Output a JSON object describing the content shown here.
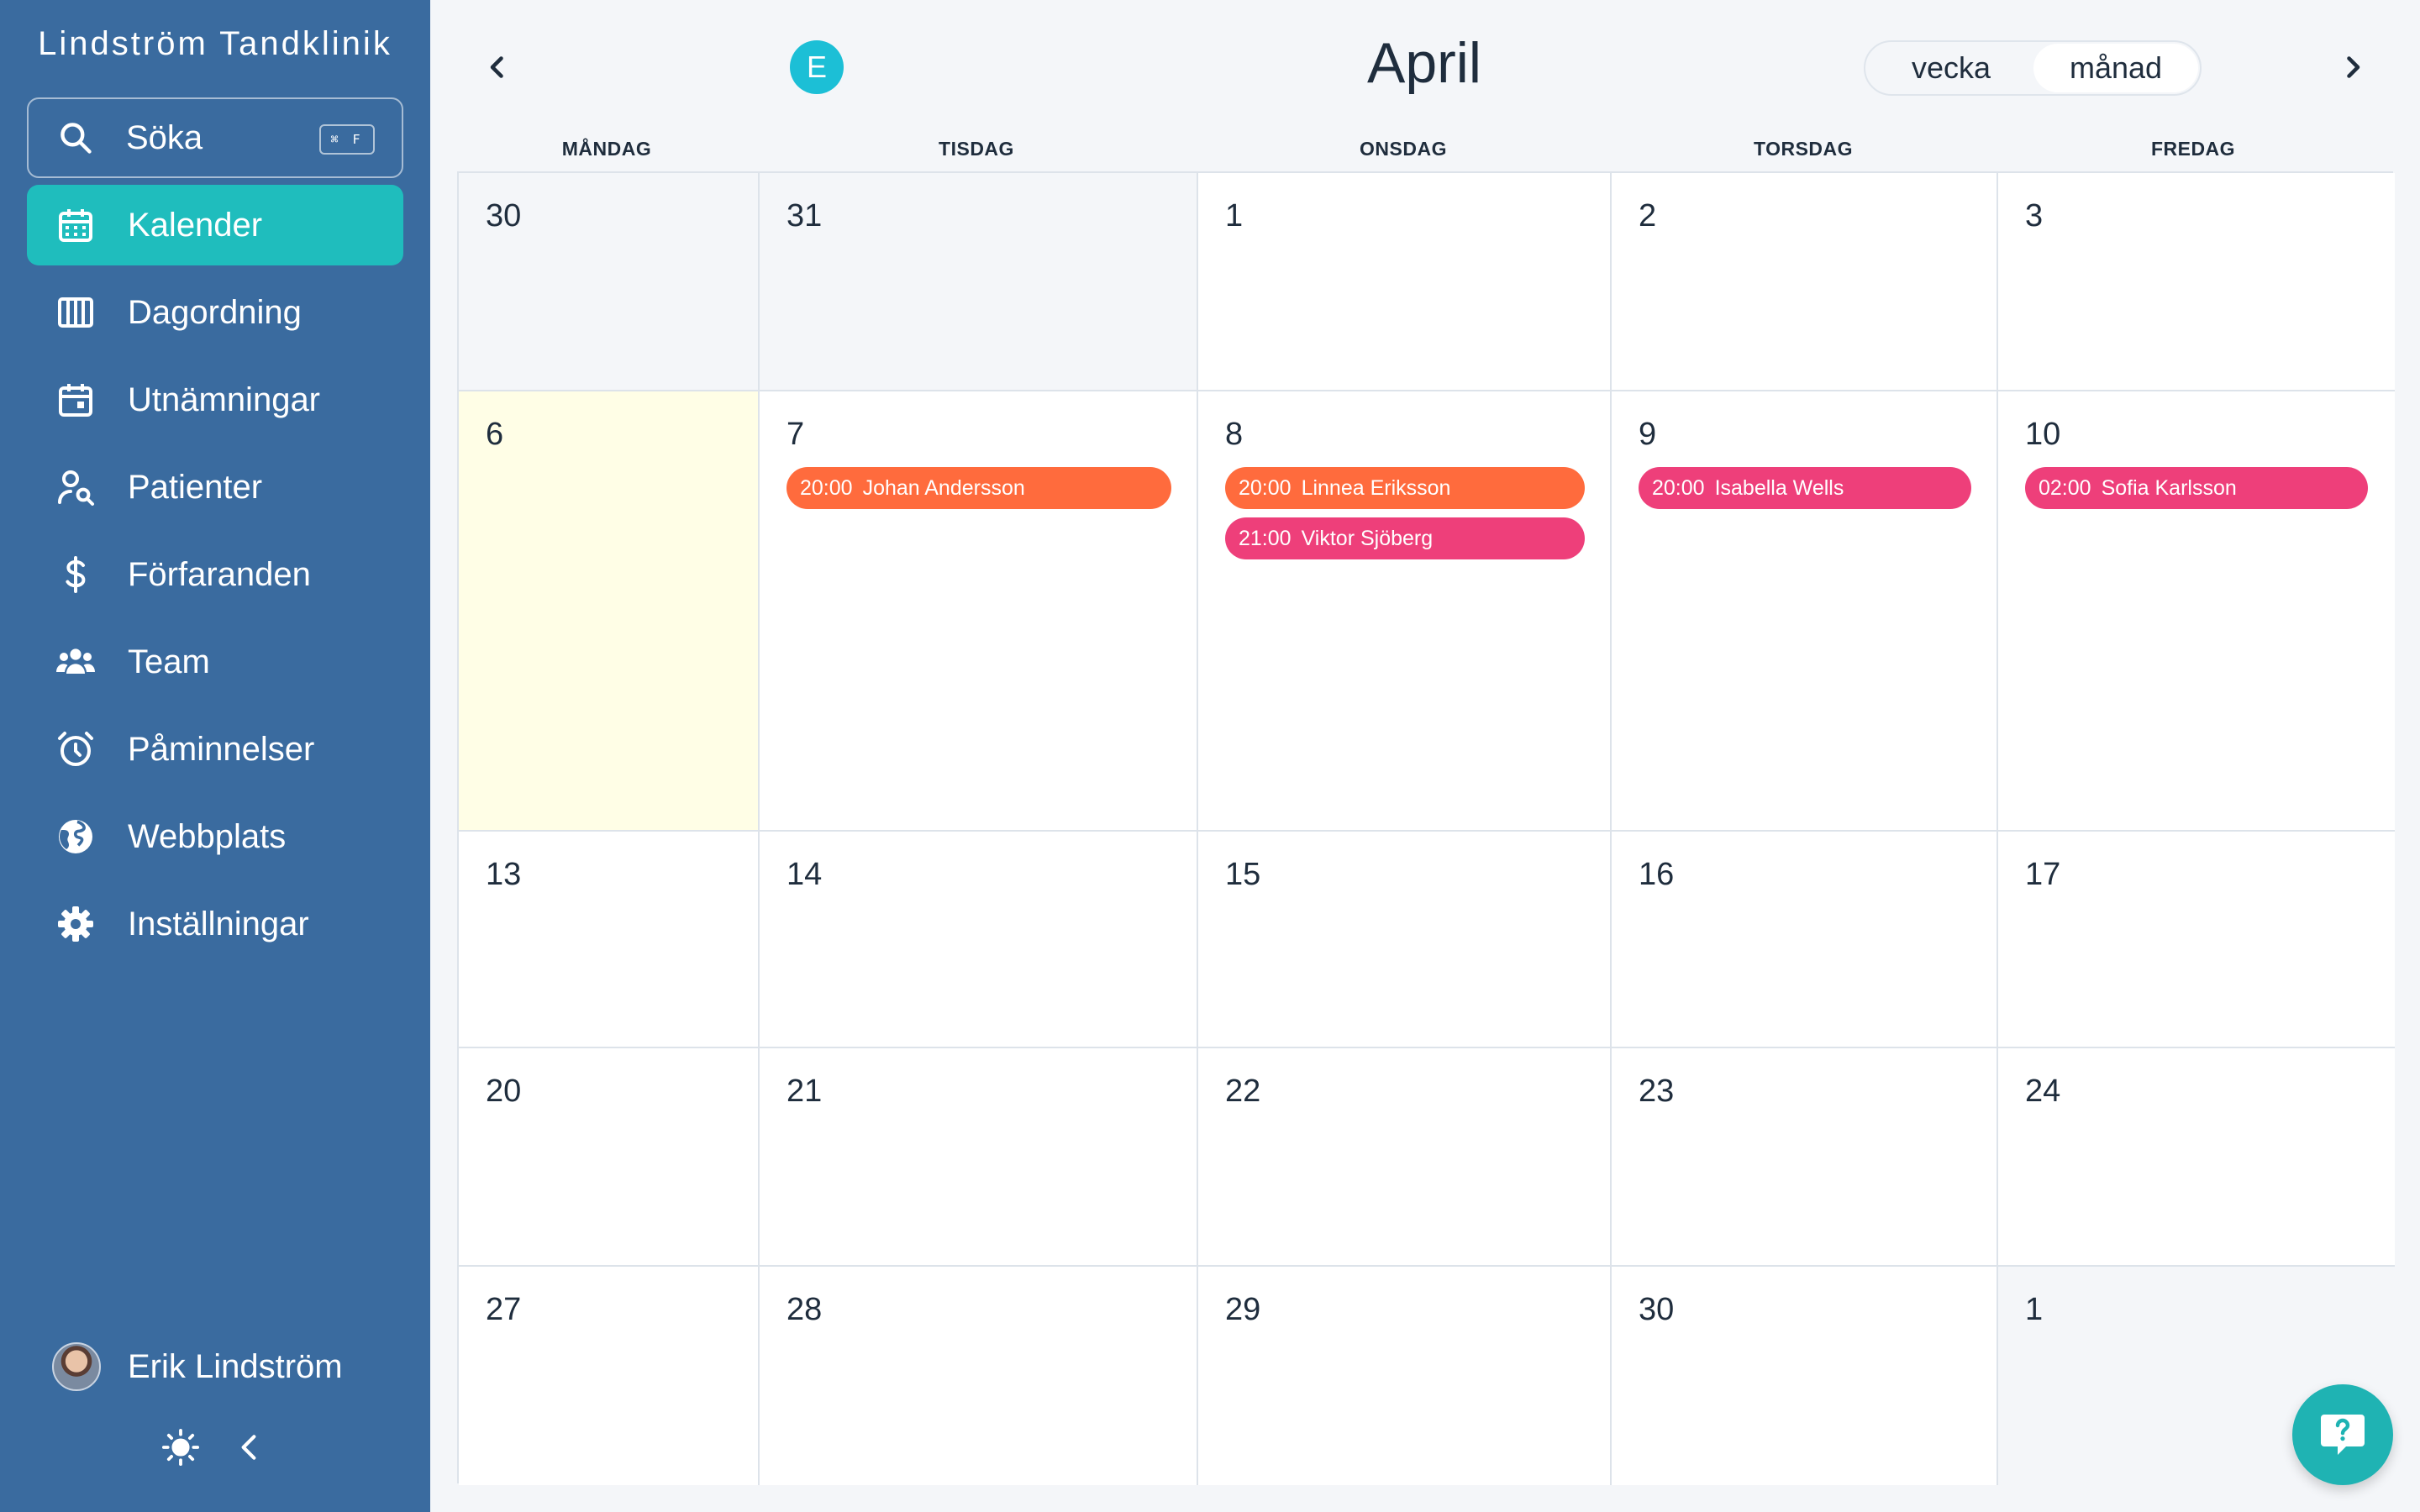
{
  "app": {
    "brand": "Lindström Tandklinik"
  },
  "search": {
    "label": "Söka",
    "shortcut": "⌘ F",
    "icon": "search-icon"
  },
  "sidebar": {
    "items": [
      {
        "label": "Kalender",
        "icon": "calendar-icon",
        "active": true
      },
      {
        "label": "Dagordning",
        "icon": "columns-icon",
        "active": false
      },
      {
        "label": "Utnämningar",
        "icon": "calendar-day-icon",
        "active": false
      },
      {
        "label": "Patienter",
        "icon": "user-search-icon",
        "active": false
      },
      {
        "label": "Förfaranden",
        "icon": "dollar-icon",
        "active": false
      },
      {
        "label": "Team",
        "icon": "users-icon",
        "active": false
      },
      {
        "label": "Påminnelser",
        "icon": "alarm-clock-icon",
        "active": false
      },
      {
        "label": "Webbplats",
        "icon": "globe-icon",
        "active": false
      },
      {
        "label": "Inställningar",
        "icon": "gear-icon",
        "active": false
      }
    ],
    "user": {
      "name": "Erik Lindström"
    }
  },
  "header": {
    "month": "April",
    "avatar_letter": "E",
    "view_options": {
      "week": "vecka",
      "month": "månad"
    },
    "selected_view": "månad"
  },
  "calendar": {
    "weekdays": [
      "MÅNDAG",
      "TISDAG",
      "ONSDAG",
      "TORSDAG",
      "FREDAG"
    ],
    "weeks": [
      [
        {
          "day": "30",
          "outside": true
        },
        {
          "day": "31",
          "outside": true
        },
        {
          "day": "1"
        },
        {
          "day": "2"
        },
        {
          "day": "3"
        }
      ],
      [
        {
          "day": "6",
          "today": true
        },
        {
          "day": "7"
        },
        {
          "day": "8"
        },
        {
          "day": "9"
        },
        {
          "day": "10"
        }
      ],
      [
        {
          "day": "13"
        },
        {
          "day": "14"
        },
        {
          "day": "15"
        },
        {
          "day": "16"
        },
        {
          "day": "17"
        }
      ],
      [
        {
          "day": "20"
        },
        {
          "day": "21"
        },
        {
          "day": "22"
        },
        {
          "day": "23"
        },
        {
          "day": "24"
        }
      ],
      [
        {
          "day": "27"
        },
        {
          "day": "28"
        },
        {
          "day": "29"
        },
        {
          "day": "30"
        },
        {
          "day": "1",
          "outside": true
        }
      ]
    ],
    "events": [
      {
        "week": 1,
        "weekday": 1,
        "time": "20:00",
        "name": "Johan Andersson",
        "color": "#ff6b3d"
      },
      {
        "week": 1,
        "weekday": 2,
        "time": "20:00",
        "name": "Linnea Eriksson",
        "color": "#ff6b3d"
      },
      {
        "week": 1,
        "weekday": 2,
        "time": "21:00",
        "name": "Viktor Sjöberg",
        "color": "#ee3f7a"
      },
      {
        "week": 1,
        "weekday": 3,
        "time": "20:00",
        "name": "Isabella Wells",
        "color": "#ee3f7a"
      },
      {
        "week": 1,
        "weekday": 4,
        "time": "02:00",
        "name": "Sofia Karlsson",
        "color": "#ee3f7a"
      }
    ]
  },
  "colors": {
    "sidebar": "#3a6b9f",
    "active_nav": "#1fbdbd",
    "today": "#fffee6",
    "help_button": "#1fb3b3"
  }
}
